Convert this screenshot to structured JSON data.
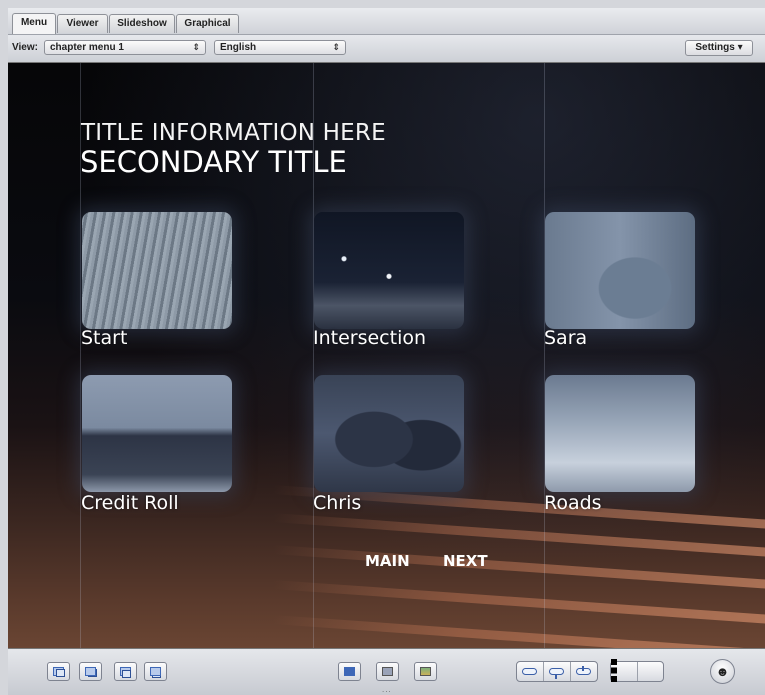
{
  "tabs": [
    "Menu",
    "Viewer",
    "Slideshow",
    "Graphical"
  ],
  "active_tab": "Menu",
  "toolbar": {
    "view_label": "View:",
    "view_select": "chapter menu 1",
    "language_select": "English",
    "settings_label": "Settings ▾",
    "popup_arrows": "⇕"
  },
  "menu_preview": {
    "title_line1": "TITLE INFORMATION HERE",
    "title_line2": "SECONDARY TITLE",
    "buttons": [
      "Start",
      "Intersection",
      "Sara",
      "Credit Roll",
      "Chris",
      "Roads"
    ],
    "nav": {
      "main": "MAIN",
      "next": "NEXT"
    }
  },
  "bottom_toolbar": {
    "tool_icons": [
      "layer-front-icon",
      "layer-back-icon",
      "layer-forward-icon",
      "layer-backward-icon",
      "add-menu-icon",
      "add-submenu-icon",
      "add-text-icon",
      "button-highlight-icon",
      "button-pin-icon",
      "button-drop-icon",
      "expand-view-icon",
      "display-safe-icon",
      "simulator-icon"
    ],
    "grip": "..."
  },
  "colors": {
    "chrome": "#d4d6db",
    "title_text": "#ffffff",
    "accent_blue": "#3d67b7"
  }
}
